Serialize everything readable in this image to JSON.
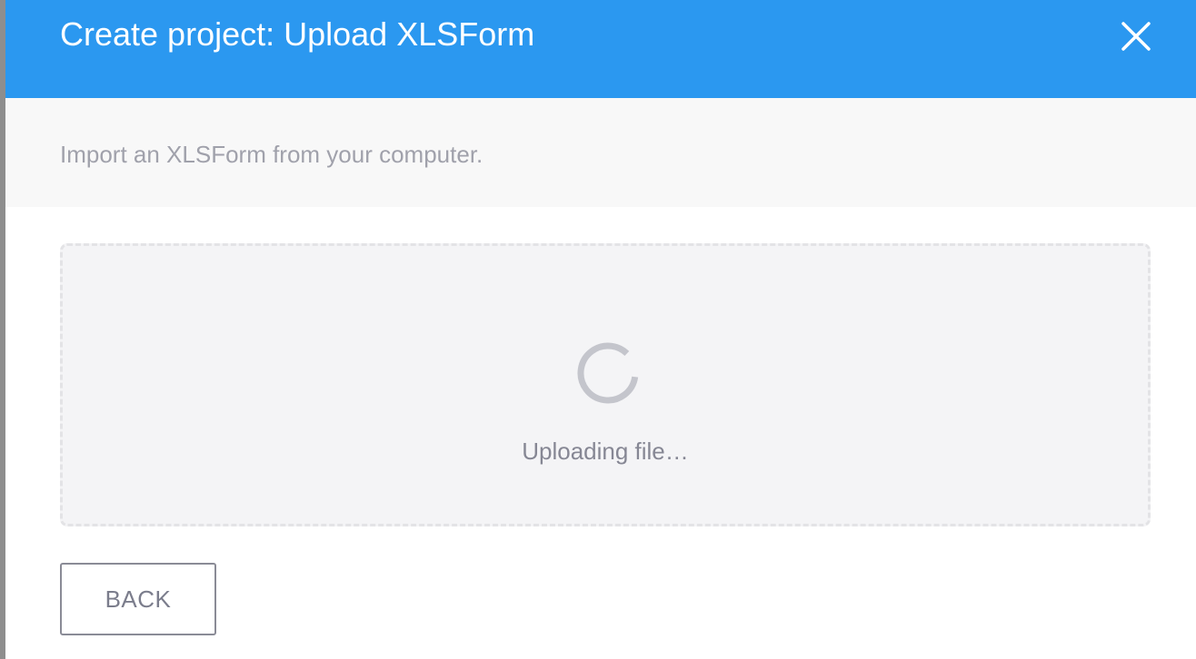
{
  "modal": {
    "title": "Create project: Upload XLSForm",
    "close_icon": "close-icon",
    "subtitle": "Import an XLSForm from your computer."
  },
  "dropzone": {
    "status_text": "Uploading file…",
    "spinner_icon": "loading-spinner-icon"
  },
  "footer": {
    "back_label": "BACK"
  },
  "colors": {
    "header_bg": "#2b98f0",
    "subheader_bg": "#f8f8f8",
    "dropzone_bg": "#f4f4f6",
    "spinner": "#c4c5cc",
    "muted_text": "#a0a1ab",
    "button_border": "#8a8b96"
  }
}
